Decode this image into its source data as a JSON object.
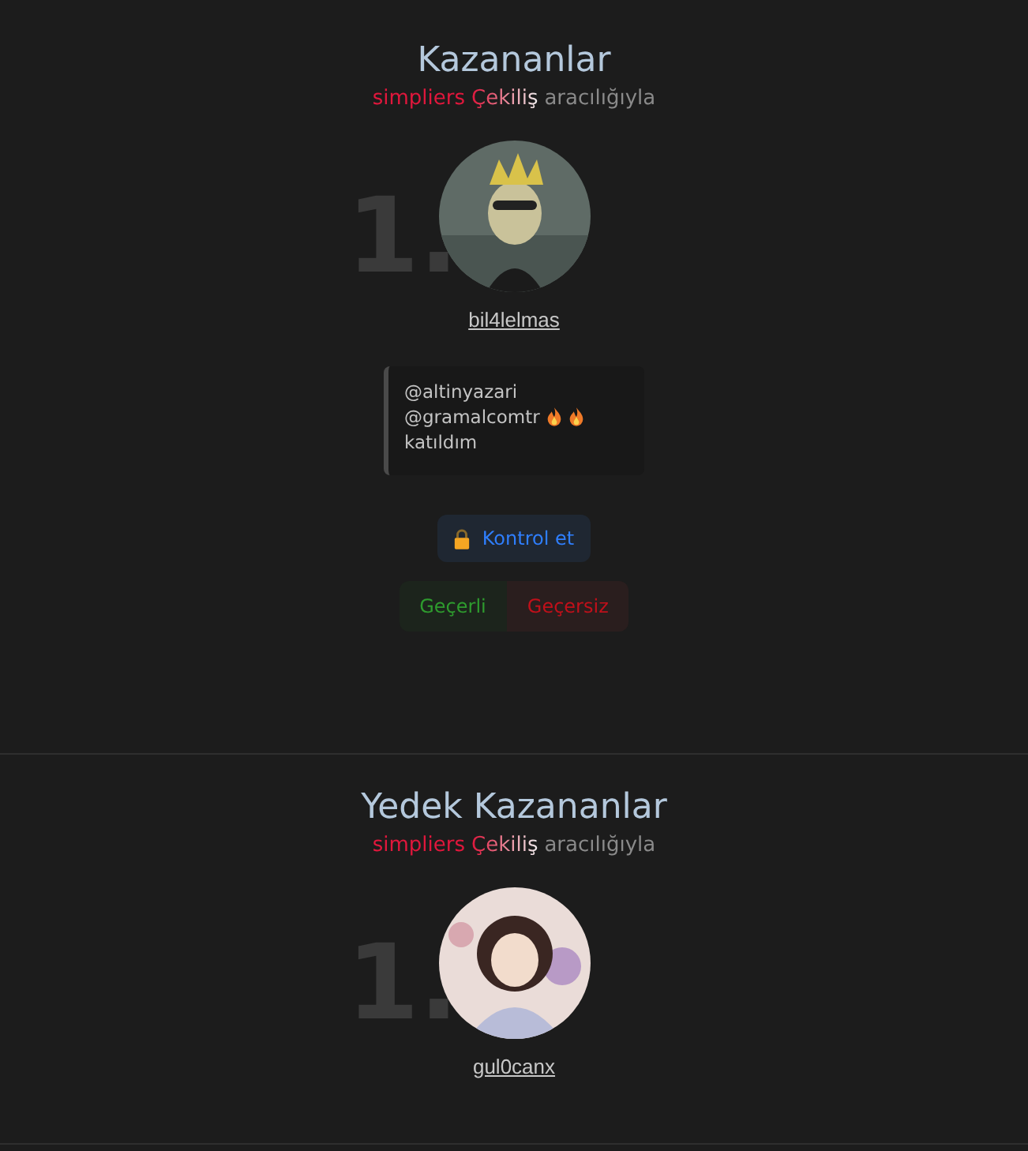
{
  "sections": [
    {
      "title": "Kazananlar",
      "subtitle": {
        "brand": "simpliers",
        "service": "Çekiliş",
        "via": "aracılığıyla"
      },
      "winners": [
        {
          "rank": "1.",
          "username": "bil4lelmas"
        }
      ],
      "comment": {
        "lines": [
          {
            "text": "@altinyazari",
            "flames": false
          },
          {
            "text": "@gramalcomtr",
            "flames": true
          },
          {
            "text": "katıldım",
            "flames": false
          }
        ]
      },
      "check_button": "Kontrol et",
      "verdict_buttons": [
        {
          "label": "Geçerli",
          "kind": "valid"
        },
        {
          "label": "Geçersiz",
          "kind": "invalid"
        }
      ]
    },
    {
      "title": "Yedek Kazananlar",
      "subtitle": {
        "brand": "simpliers",
        "service": "Çekiliş",
        "via": "aracılığıyla"
      },
      "winners": [
        {
          "rank": "1.",
          "username": "gul0canx"
        }
      ]
    }
  ]
}
